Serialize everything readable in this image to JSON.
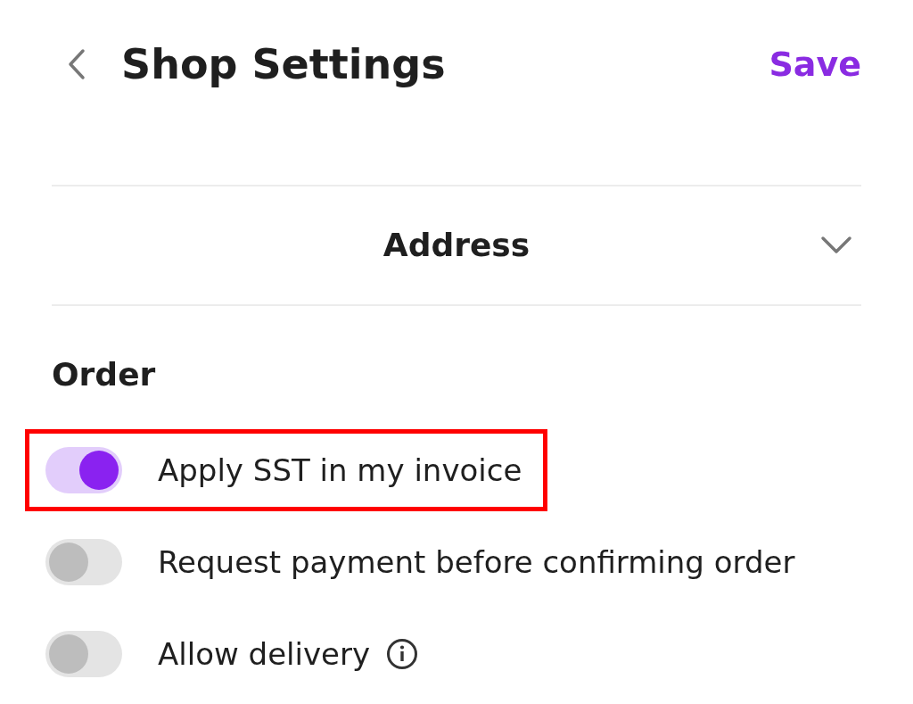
{
  "header": {
    "title": "Shop Settings",
    "action": "Save"
  },
  "section_header": {
    "label": "Address",
    "expanded": false
  },
  "order": {
    "title": "Order",
    "toggles": [
      {
        "label": "Apply SST in my invoice",
        "on": true,
        "highlighted": true,
        "info": false
      },
      {
        "label": "Request payment before confirming order",
        "on": false,
        "highlighted": false,
        "info": false
      },
      {
        "label": "Allow delivery",
        "on": false,
        "highlighted": false,
        "info": true
      }
    ]
  }
}
